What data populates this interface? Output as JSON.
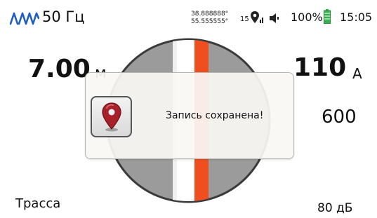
{
  "status_bar": {
    "frequency": "50 Гц",
    "latitude": "38.888888°",
    "longitude": "55.555555°",
    "satellites": "15",
    "battery_percent": "100%",
    "time": "15:05",
    "icons": [
      "signal-wave-icon",
      "gps-pin-icon",
      "speaker-icon",
      "battery-icon"
    ]
  },
  "readings": {
    "depth_value": "7.00",
    "depth_unit": "м",
    "current_value": "110",
    "current_unit": "А",
    "side_value": "600",
    "mode": "Трасса",
    "gain": "80 дБ"
  },
  "toast": {
    "message": "Запись сохранена!",
    "icon": "location-pin-icon"
  },
  "colors": {
    "accent_orange": "#f04e1e",
    "compass_gray": "#9a9a9a",
    "battery_green": "#37b24d",
    "wave_blue": "#1f5fbf",
    "pin_red": "#a8202a"
  }
}
